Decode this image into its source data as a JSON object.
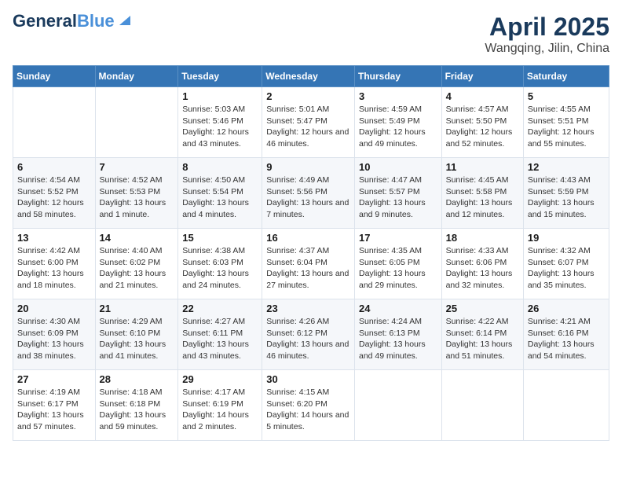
{
  "logo": {
    "part1": "General",
    "part2": "Blue"
  },
  "title": "April 2025",
  "subtitle": "Wangqing, Jilin, China",
  "weekdays": [
    "Sunday",
    "Monday",
    "Tuesday",
    "Wednesday",
    "Thursday",
    "Friday",
    "Saturday"
  ],
  "weeks": [
    [
      {
        "day": "",
        "sunrise": "",
        "sunset": "",
        "daylight": ""
      },
      {
        "day": "",
        "sunrise": "",
        "sunset": "",
        "daylight": ""
      },
      {
        "day": "1",
        "sunrise": "Sunrise: 5:03 AM",
        "sunset": "Sunset: 5:46 PM",
        "daylight": "Daylight: 12 hours and 43 minutes."
      },
      {
        "day": "2",
        "sunrise": "Sunrise: 5:01 AM",
        "sunset": "Sunset: 5:47 PM",
        "daylight": "Daylight: 12 hours and 46 minutes."
      },
      {
        "day": "3",
        "sunrise": "Sunrise: 4:59 AM",
        "sunset": "Sunset: 5:49 PM",
        "daylight": "Daylight: 12 hours and 49 minutes."
      },
      {
        "day": "4",
        "sunrise": "Sunrise: 4:57 AM",
        "sunset": "Sunset: 5:50 PM",
        "daylight": "Daylight: 12 hours and 52 minutes."
      },
      {
        "day": "5",
        "sunrise": "Sunrise: 4:55 AM",
        "sunset": "Sunset: 5:51 PM",
        "daylight": "Daylight: 12 hours and 55 minutes."
      }
    ],
    [
      {
        "day": "6",
        "sunrise": "Sunrise: 4:54 AM",
        "sunset": "Sunset: 5:52 PM",
        "daylight": "Daylight: 12 hours and 58 minutes."
      },
      {
        "day": "7",
        "sunrise": "Sunrise: 4:52 AM",
        "sunset": "Sunset: 5:53 PM",
        "daylight": "Daylight: 13 hours and 1 minute."
      },
      {
        "day": "8",
        "sunrise": "Sunrise: 4:50 AM",
        "sunset": "Sunset: 5:54 PM",
        "daylight": "Daylight: 13 hours and 4 minutes."
      },
      {
        "day": "9",
        "sunrise": "Sunrise: 4:49 AM",
        "sunset": "Sunset: 5:56 PM",
        "daylight": "Daylight: 13 hours and 7 minutes."
      },
      {
        "day": "10",
        "sunrise": "Sunrise: 4:47 AM",
        "sunset": "Sunset: 5:57 PM",
        "daylight": "Daylight: 13 hours and 9 minutes."
      },
      {
        "day": "11",
        "sunrise": "Sunrise: 4:45 AM",
        "sunset": "Sunset: 5:58 PM",
        "daylight": "Daylight: 13 hours and 12 minutes."
      },
      {
        "day": "12",
        "sunrise": "Sunrise: 4:43 AM",
        "sunset": "Sunset: 5:59 PM",
        "daylight": "Daylight: 13 hours and 15 minutes."
      }
    ],
    [
      {
        "day": "13",
        "sunrise": "Sunrise: 4:42 AM",
        "sunset": "Sunset: 6:00 PM",
        "daylight": "Daylight: 13 hours and 18 minutes."
      },
      {
        "day": "14",
        "sunrise": "Sunrise: 4:40 AM",
        "sunset": "Sunset: 6:02 PM",
        "daylight": "Daylight: 13 hours and 21 minutes."
      },
      {
        "day": "15",
        "sunrise": "Sunrise: 4:38 AM",
        "sunset": "Sunset: 6:03 PM",
        "daylight": "Daylight: 13 hours and 24 minutes."
      },
      {
        "day": "16",
        "sunrise": "Sunrise: 4:37 AM",
        "sunset": "Sunset: 6:04 PM",
        "daylight": "Daylight: 13 hours and 27 minutes."
      },
      {
        "day": "17",
        "sunrise": "Sunrise: 4:35 AM",
        "sunset": "Sunset: 6:05 PM",
        "daylight": "Daylight: 13 hours and 29 minutes."
      },
      {
        "day": "18",
        "sunrise": "Sunrise: 4:33 AM",
        "sunset": "Sunset: 6:06 PM",
        "daylight": "Daylight: 13 hours and 32 minutes."
      },
      {
        "day": "19",
        "sunrise": "Sunrise: 4:32 AM",
        "sunset": "Sunset: 6:07 PM",
        "daylight": "Daylight: 13 hours and 35 minutes."
      }
    ],
    [
      {
        "day": "20",
        "sunrise": "Sunrise: 4:30 AM",
        "sunset": "Sunset: 6:09 PM",
        "daylight": "Daylight: 13 hours and 38 minutes."
      },
      {
        "day": "21",
        "sunrise": "Sunrise: 4:29 AM",
        "sunset": "Sunset: 6:10 PM",
        "daylight": "Daylight: 13 hours and 41 minutes."
      },
      {
        "day": "22",
        "sunrise": "Sunrise: 4:27 AM",
        "sunset": "Sunset: 6:11 PM",
        "daylight": "Daylight: 13 hours and 43 minutes."
      },
      {
        "day": "23",
        "sunrise": "Sunrise: 4:26 AM",
        "sunset": "Sunset: 6:12 PM",
        "daylight": "Daylight: 13 hours and 46 minutes."
      },
      {
        "day": "24",
        "sunrise": "Sunrise: 4:24 AM",
        "sunset": "Sunset: 6:13 PM",
        "daylight": "Daylight: 13 hours and 49 minutes."
      },
      {
        "day": "25",
        "sunrise": "Sunrise: 4:22 AM",
        "sunset": "Sunset: 6:14 PM",
        "daylight": "Daylight: 13 hours and 51 minutes."
      },
      {
        "day": "26",
        "sunrise": "Sunrise: 4:21 AM",
        "sunset": "Sunset: 6:16 PM",
        "daylight": "Daylight: 13 hours and 54 minutes."
      }
    ],
    [
      {
        "day": "27",
        "sunrise": "Sunrise: 4:19 AM",
        "sunset": "Sunset: 6:17 PM",
        "daylight": "Daylight: 13 hours and 57 minutes."
      },
      {
        "day": "28",
        "sunrise": "Sunrise: 4:18 AM",
        "sunset": "Sunset: 6:18 PM",
        "daylight": "Daylight: 13 hours and 59 minutes."
      },
      {
        "day": "29",
        "sunrise": "Sunrise: 4:17 AM",
        "sunset": "Sunset: 6:19 PM",
        "daylight": "Daylight: 14 hours and 2 minutes."
      },
      {
        "day": "30",
        "sunrise": "Sunrise: 4:15 AM",
        "sunset": "Sunset: 6:20 PM",
        "daylight": "Daylight: 14 hours and 5 minutes."
      },
      {
        "day": "",
        "sunrise": "",
        "sunset": "",
        "daylight": ""
      },
      {
        "day": "",
        "sunrise": "",
        "sunset": "",
        "daylight": ""
      },
      {
        "day": "",
        "sunrise": "",
        "sunset": "",
        "daylight": ""
      }
    ]
  ]
}
